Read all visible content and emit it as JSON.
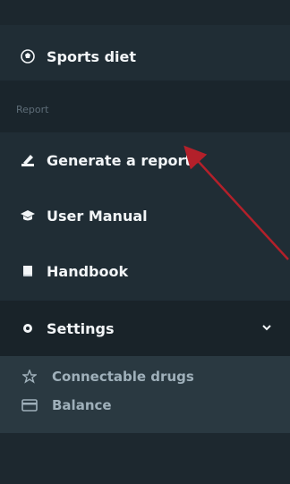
{
  "sidebar": {
    "items": [
      {
        "label": "Sports diet",
        "icon": "soccer-ball-icon"
      },
      {
        "label": "Generate a report",
        "icon": "report-edit-icon"
      },
      {
        "label": "User Manual",
        "icon": "graduation-cap-icon"
      },
      {
        "label": "Handbook",
        "icon": "book-icon"
      },
      {
        "label": "Settings",
        "icon": "gear-icon"
      }
    ],
    "section_label": "Report",
    "submenu": [
      {
        "label": "Connectable drugs",
        "icon": "star-hand-icon"
      },
      {
        "label": "Balance",
        "icon": "credit-card-icon"
      }
    ]
  },
  "colors": {
    "background": "#202d35",
    "text": "#f2f5f7",
    "subtext": "#9fb0ba",
    "annotation_arrow": "#b3202a"
  }
}
